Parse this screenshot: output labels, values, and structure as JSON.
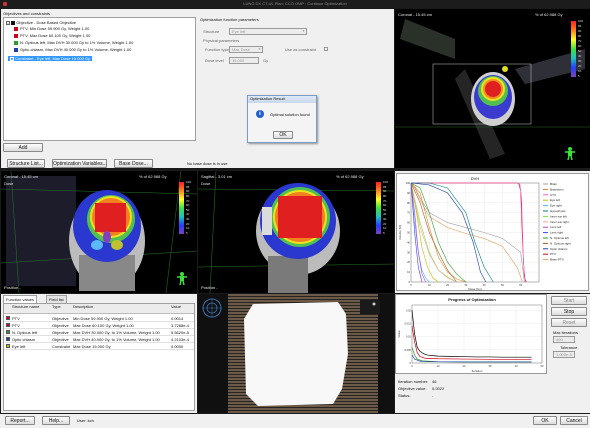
{
  "window": {
    "title": "LUNG DX CT-UL Plan: CCO OMP : Continue Optimization"
  },
  "objectives_panel": {
    "label": "Objectives and constraints",
    "group_label": "Objective - Dose Based Objective",
    "items": [
      {
        "label": "PTV, Min Dose 59.900 Gy, Weight 1.00",
        "color": "#d0021b"
      },
      {
        "label": "PTV, Max Dose 60.100 Gy, Weight 1.00",
        "color": "#d0021b"
      },
      {
        "label": "N. Opticus left, Max DVH 30.000 Gy to 1% Volume, Weight 1.00",
        "color": "#2e9b2e"
      },
      {
        "label": "Optic chiasm, Max DVH 40.000 Gy to 1% Volume, Weight 1.00",
        "color": "#1d3fa8"
      }
    ],
    "constraint_label": "Constraint - Eye left, Max Dose 15.000 Gy",
    "add_button": "Add"
  },
  "opt_params": {
    "label": "Optimization function parameters",
    "structure_label": "Structure",
    "structure_value": "Eye left",
    "physical_label": "Physical parameters",
    "function_type_label": "Function type",
    "function_type_value": "Max Dose",
    "use_as_constraint": "Use as constraint",
    "dose_level_label": "Dose level",
    "dose_level_value": "15.000",
    "dose_unit": "Gy"
  },
  "dialog": {
    "title": "Optimization Result",
    "message": "Optimal solution found",
    "ok": "OK"
  },
  "toolbar": {
    "structure_list": "Structure List...",
    "optimization_variables": "Optimization Variables...",
    "base_dose": "Base Dose...",
    "status": "No base dose is in use"
  },
  "viewports": {
    "top_right": {
      "title": "Coronal - 15.45 cm",
      "pct": "% of 62.988 Gy"
    },
    "coronal": {
      "title": "Coronal - 15.45 cm",
      "pct": "% of 62.988 Gy",
      "sub": "Dose",
      "position": "Position -"
    },
    "sagittal": {
      "title": "Sagittal - 3.01 cm",
      "pct": "% of 62.988 Gy",
      "sub": "Dose",
      "position": "Position -"
    }
  },
  "colorbar_ticks": [
    "100",
    "95",
    "90",
    "80",
    "70",
    "60",
    "50",
    "40",
    "30",
    "20",
    "10",
    "5"
  ],
  "dvh": {
    "title": "DVH",
    "xlabel": "Dose [Gy]",
    "ylabel": "Volume [%]",
    "legend": [
      {
        "name": "Brain",
        "color": "#a0a0a0"
      },
      {
        "name": "Brainstem",
        "color": "#e08020"
      },
      {
        "name": "CTV",
        "color": "#ff60c0"
      },
      {
        "name": "Eye left",
        "color": "#c0c000"
      },
      {
        "name": "Eye right",
        "color": "#40c0ff"
      },
      {
        "name": "Hypophysis",
        "color": "#008080"
      },
      {
        "name": "Inner ear left",
        "color": "#80e040"
      },
      {
        "name": "Inner ear right",
        "color": "#ffa0a0"
      },
      {
        "name": "Lens left",
        "color": "#c040c0"
      },
      {
        "name": "Lens right",
        "color": "#4040ff"
      },
      {
        "name": "N. Opticus left",
        "color": "#2e9b2e"
      },
      {
        "name": "N. Opticus right",
        "color": "#a06020"
      },
      {
        "name": "Optic chiasm",
        "color": "#1d3fa8"
      },
      {
        "name": "PTV",
        "color": "#d0021b"
      },
      {
        "name": "Brain-PTV",
        "color": "#e0a060"
      }
    ],
    "x_ticks": [
      "0",
      "10",
      "20",
      "30",
      "40",
      "50",
      "60"
    ],
    "y_ticks": [
      "100",
      "90",
      "80",
      "70",
      "60",
      "50",
      "40",
      "30",
      "20",
      "10",
      "0"
    ]
  },
  "function_values": {
    "tabs": [
      "Function values",
      "Field list"
    ],
    "headers": [
      "",
      "Structure name",
      "Type",
      "Description",
      "Value"
    ],
    "rows": [
      {
        "color": "#d0021b",
        "name": "PTV",
        "type": "Objective",
        "desc": "Min Dose 59.900 Gy, Weight 1.00",
        "value": "0.0014"
      },
      {
        "color": "#d0021b",
        "name": "PTV",
        "type": "Objective",
        "desc": "Max Dose 60.100 Gy, Weight 1.00",
        "value": "3.7288e-4"
      },
      {
        "color": "#2e9b2e",
        "name": "N. Opticus left",
        "type": "Objective",
        "desc": "Max DVH 30.000 Gy, to 1% Volume, Weight 1.00",
        "value": "5.5620e-5"
      },
      {
        "color": "#1d3fa8",
        "name": "Optic chiasm",
        "type": "Objective",
        "desc": "Max DVH 40.000 Gy, to 1% Volume, Weight 1.00",
        "value": "4.2103e-4"
      },
      {
        "color": "#c0c000",
        "name": "Eye left",
        "type": "Constraint",
        "desc": "Max Dose 15.000 Gy",
        "value": "0.0000"
      }
    ]
  },
  "progress": {
    "title": "Progress of Optimization",
    "xlabel": "Iteration",
    "ylabel": "Value",
    "x_ticks": [
      "0",
      "10",
      "20",
      "30",
      "40",
      "50"
    ],
    "y_ticks": [
      "0.02",
      "0.015",
      "0.01",
      "0.005",
      "0"
    ],
    "iteration_label": "Iteration number:",
    "iteration_value": "46",
    "objective_label": "Objective value:",
    "objective_value": "0.0022",
    "status_label": "Status:",
    "status_value": "-"
  },
  "side_controls": {
    "start": "Start",
    "stop": "Stop",
    "reset": "Reset",
    "max_iter_label": "Max iterations",
    "max_iter_value": "400",
    "tolerance_label": "Tolerance",
    "tolerance_value": "1.000e-5"
  },
  "footer": {
    "report": "Report...",
    "help": "Help...",
    "user": "User: kch",
    "ok": "OK",
    "cancel": "Cancel"
  },
  "chart_data": [
    {
      "type": "line",
      "title": "DVH",
      "xlabel": "Dose [Gy]",
      "ylabel": "Volume [%]",
      "xlim": [
        0,
        70
      ],
      "ylim": [
        0,
        100
      ],
      "series": [
        {
          "name": "PTV",
          "color": "#d0021b",
          "x": [
            0,
            58,
            59,
            60,
            61,
            62,
            63
          ],
          "y": [
            100,
            100,
            99,
            92,
            40,
            5,
            0
          ]
        },
        {
          "name": "CTV",
          "color": "#ff60c0",
          "x": [
            0,
            58,
            59.5,
            60.5,
            61.5,
            62.5
          ],
          "y": [
            100,
            100,
            99,
            85,
            20,
            0
          ]
        },
        {
          "name": "Brain",
          "color": "#a0a0a0",
          "x": [
            0,
            2,
            5,
            10,
            20,
            30,
            40,
            50,
            60,
            62
          ],
          "y": [
            100,
            96,
            85,
            70,
            60,
            55,
            50,
            44,
            30,
            0
          ]
        },
        {
          "name": "Brain-PTV",
          "color": "#e0a060",
          "x": [
            0,
            2,
            5,
            10,
            20,
            30,
            40,
            50,
            58,
            61
          ],
          "y": [
            100,
            95,
            83,
            66,
            55,
            49,
            44,
            36,
            15,
            0
          ]
        },
        {
          "name": "Brainstem",
          "color": "#e08020",
          "x": [
            0,
            5,
            10,
            15,
            20,
            25,
            30
          ],
          "y": [
            100,
            90,
            55,
            25,
            10,
            3,
            0
          ]
        },
        {
          "name": "Hypophysis",
          "color": "#008080",
          "x": [
            0,
            10,
            20,
            30,
            35,
            40,
            45
          ],
          "y": [
            100,
            100,
            95,
            70,
            40,
            15,
            0
          ]
        },
        {
          "name": "Optic chiasm",
          "color": "#1d3fa8",
          "x": [
            0,
            10,
            20,
            28,
            34,
            38,
            41
          ],
          "y": [
            100,
            98,
            90,
            70,
            40,
            10,
            0
          ]
        },
        {
          "name": "N. Opticus left",
          "color": "#2e9b2e",
          "x": [
            0,
            5,
            10,
            15,
            20,
            25,
            30
          ],
          "y": [
            100,
            95,
            70,
            40,
            20,
            8,
            0
          ]
        },
        {
          "name": "N. Opticus right",
          "color": "#a06020",
          "x": [
            0,
            5,
            10,
            15,
            20,
            25
          ],
          "y": [
            100,
            80,
            50,
            30,
            12,
            0
          ]
        },
        {
          "name": "Inner ear left",
          "color": "#80e040",
          "x": [
            0,
            5,
            10,
            15,
            20,
            25
          ],
          "y": [
            100,
            60,
            30,
            12,
            5,
            0
          ]
        },
        {
          "name": "Inner ear right",
          "color": "#ffa0a0",
          "x": [
            0,
            5,
            10,
            15,
            20,
            25
          ],
          "y": [
            100,
            55,
            28,
            12,
            4,
            0
          ]
        },
        {
          "name": "Eye left",
          "color": "#c0c000",
          "x": [
            0,
            3,
            6,
            9,
            12,
            15
          ],
          "y": [
            100,
            70,
            35,
            15,
            4,
            0
          ]
        },
        {
          "name": "Eye right",
          "color": "#40c0ff",
          "x": [
            0,
            2,
            4,
            6,
            8,
            10
          ],
          "y": [
            100,
            60,
            30,
            12,
            4,
            0
          ]
        },
        {
          "name": "Lens left",
          "color": "#c040c0",
          "x": [
            0,
            2,
            4,
            6,
            8
          ],
          "y": [
            100,
            70,
            30,
            8,
            0
          ]
        },
        {
          "name": "Lens right",
          "color": "#4040ff",
          "x": [
            0,
            2,
            4,
            6
          ],
          "y": [
            100,
            50,
            15,
            0
          ]
        }
      ]
    },
    {
      "type": "line",
      "title": "Progress of Optimization",
      "xlabel": "Iteration",
      "ylabel": "Value",
      "xlim": [
        0,
        50
      ],
      "ylim": [
        0,
        0.022
      ],
      "series": [
        {
          "color": "#000000",
          "x": [
            0,
            1,
            2,
            3,
            4,
            5,
            6,
            8,
            10,
            15,
            20,
            25,
            30,
            35,
            40,
            46
          ],
          "y": [
            0.02,
            0.011,
            0.006,
            0.0045,
            0.0038,
            0.0033,
            0.003,
            0.0028,
            0.0026,
            0.0025,
            0.0024,
            0.0023,
            0.0023,
            0.0022,
            0.0022,
            0.0022
          ]
        },
        {
          "color": "#d0021b",
          "x": [
            0,
            1,
            2,
            3,
            5,
            10,
            20,
            30,
            46
          ],
          "y": [
            0.014,
            0.008,
            0.004,
            0.0025,
            0.0018,
            0.0016,
            0.0015,
            0.0014,
            0.0014
          ]
        },
        {
          "color": "#2e9b2e",
          "x": [
            0,
            1,
            2,
            4,
            10,
            20,
            46
          ],
          "y": [
            0.006,
            0.003,
            0.0015,
            0.0008,
            0.0005,
            0.0004,
            0.0004
          ]
        },
        {
          "color": "#1d3fa8",
          "x": [
            0,
            1,
            3,
            6,
            20,
            46
          ],
          "y": [
            0.003,
            0.0015,
            0.0007,
            0.0005,
            0.0004,
            0.0004
          ]
        }
      ]
    }
  ]
}
